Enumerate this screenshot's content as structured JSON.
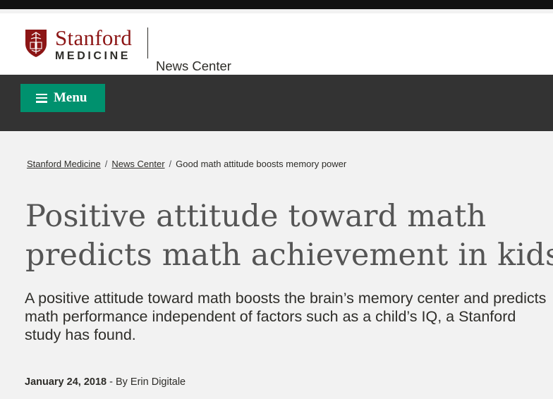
{
  "logo": {
    "stanford": "Stanford",
    "medicine": "MEDICINE",
    "news_center": "News Center"
  },
  "nav": {
    "menu_label": "Menu"
  },
  "breadcrumb": {
    "items": [
      "Stanford Medicine",
      "News Center"
    ],
    "separator": "/",
    "current": "Good math attitude boosts memory power"
  },
  "article": {
    "headline_line1": "Positive attitude toward math",
    "headline_line2": "predicts math achievement in kids",
    "dek": "A positive attitude toward math boosts the brain’s memory center and predicts math performance independent of factors such as a child’s IQ, a Stanford study has found.",
    "date": "January 24, 2018",
    "byline": " - By Erin Digitale"
  },
  "colors": {
    "cardinal": "#8c1515",
    "menu_green": "#00916e",
    "nav_dark": "#333333",
    "page_bg": "#f2f2f2"
  }
}
